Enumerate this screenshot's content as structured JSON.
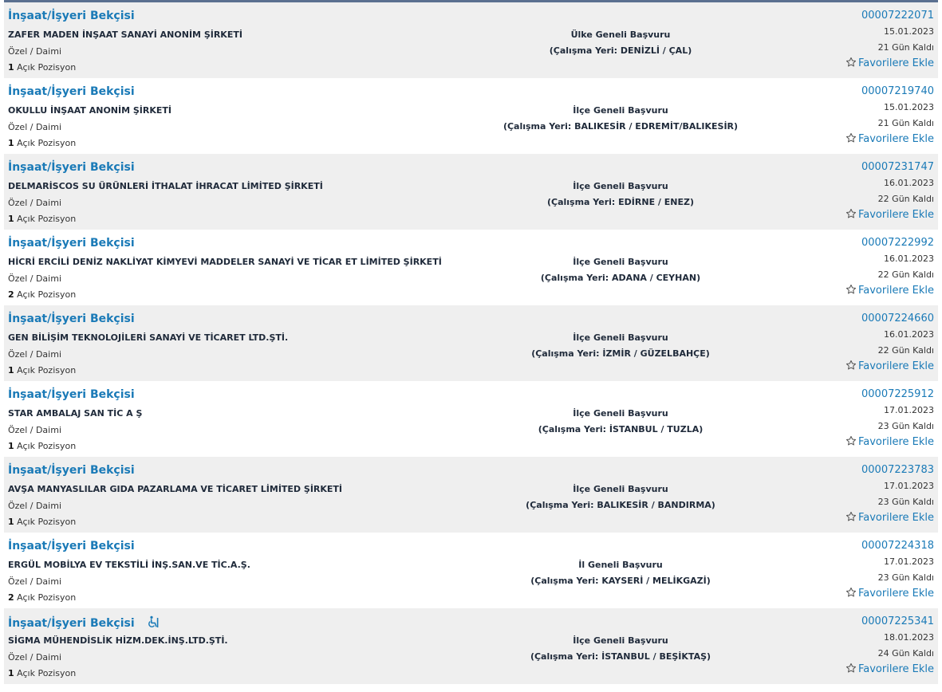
{
  "favorite_label": "Favorilere Ekle",
  "position_suffix": "Açık Pozisyon",
  "colors": {
    "link": "#1a7ab7",
    "row_alt": "#efefef",
    "text_dark": "#1f2a3a"
  },
  "icons": {
    "favorite": "star-outline-icon",
    "accessibility": "wheelchair-icon"
  },
  "jobs": [
    {
      "title": "İnşaat/İşyeri Bekçisi",
      "company": "ZAFER MADEN İNŞAAT SANAYİ ANONİM ŞİRKETİ",
      "type": "Özel / Daimi",
      "positions": "1",
      "scope": "Ülke Geneli Başvuru",
      "location": "(Çalışma Yeri: DENİZLİ / ÇAL)",
      "ilan_no": "00007222071",
      "date": "15.01.2023",
      "days_left": "21 Gün Kaldı"
    },
    {
      "title": "İnşaat/İşyeri Bekçisi",
      "company": "OKULLU İNŞAAT ANONİM ŞİRKETİ",
      "type": "Özel / Daimi",
      "positions": "1",
      "scope": "İlçe Geneli Başvuru",
      "location": "(Çalışma Yeri: BALIKESİR / EDREMİT/BALIKESİR)",
      "ilan_no": "00007219740",
      "date": "15.01.2023",
      "days_left": "21 Gün Kaldı"
    },
    {
      "title": "İnşaat/İşyeri Bekçisi",
      "company": "DELMARİSCOS SU ÜRÜNLERİ İTHALAT İHRACAT LİMİTED ŞİRKETİ",
      "type": "Özel / Daimi",
      "positions": "1",
      "scope": "İlçe Geneli Başvuru",
      "location": "(Çalışma Yeri: EDİRNE / ENEZ)",
      "ilan_no": "00007231747",
      "date": "16.01.2023",
      "days_left": "22 Gün Kaldı"
    },
    {
      "title": "İnşaat/İşyeri Bekçisi",
      "company": "HİCRİ ERCİLİ DENİZ NAKLİYAT KİMYEVİ MADDELER SANAYİ VE TİCAR ET LİMİTED ŞİRKETİ",
      "type": "Özel / Daimi",
      "positions": "2",
      "scope": "İlçe Geneli Başvuru",
      "location": "(Çalışma Yeri: ADANA / CEYHAN)",
      "ilan_no": "00007222992",
      "date": "16.01.2023",
      "days_left": "22 Gün Kaldı"
    },
    {
      "title": "İnşaat/İşyeri Bekçisi",
      "company": "GEN BİLİŞİM TEKNOLOJİLERİ SANAYİ VE TİCARET LTD.ŞTİ.",
      "type": "Özel / Daimi",
      "positions": "1",
      "scope": "İlçe Geneli Başvuru",
      "location": "(Çalışma Yeri: İZMİR / GÜZELBAHÇE)",
      "ilan_no": "00007224660",
      "date": "16.01.2023",
      "days_left": "22 Gün Kaldı"
    },
    {
      "title": "İnşaat/İşyeri Bekçisi",
      "company": "STAR AMBALAJ SAN TİC A Ş",
      "type": "Özel / Daimi",
      "positions": "1",
      "scope": "İlçe Geneli Başvuru",
      "location": "(Çalışma Yeri: İSTANBUL / TUZLA)",
      "ilan_no": "00007225912",
      "date": "17.01.2023",
      "days_left": "23 Gün Kaldı"
    },
    {
      "title": "İnşaat/İşyeri Bekçisi",
      "company": "AVŞA MANYASLILAR GIDA PAZARLAMA VE TİCARET LİMİTED ŞİRKETİ",
      "type": "Özel / Daimi",
      "positions": "1",
      "scope": "İlçe Geneli Başvuru",
      "location": "(Çalışma Yeri: BALIKESİR / BANDIRMA)",
      "ilan_no": "00007223783",
      "date": "17.01.2023",
      "days_left": "23 Gün Kaldı"
    },
    {
      "title": "İnşaat/İşyeri Bekçisi",
      "company": "ERGÜL MOBİLYA EV TEKSTİLİ İNŞ.SAN.VE TİC.A.Ş.",
      "type": "Özel / Daimi",
      "positions": "2",
      "scope": "İl Geneli Başvuru",
      "location": "(Çalışma Yeri: KAYSERİ / MELİKGAZİ)",
      "ilan_no": "00007224318",
      "date": "17.01.2023",
      "days_left": "23 Gün Kaldı"
    },
    {
      "title": "İnşaat/İşyeri Bekçisi",
      "company": "SİGMA MÜHENDİSLİK HİZM.DEK.İNŞ.LTD.ŞTİ.",
      "type": "Özel / Daimi",
      "positions": "1",
      "scope": "İlçe Geneli Başvuru",
      "location": "(Çalışma Yeri: İSTANBUL / BEŞİKTAŞ)",
      "ilan_no": "00007225341",
      "date": "18.01.2023",
      "days_left": "24 Gün Kaldı",
      "accessible": true
    }
  ]
}
